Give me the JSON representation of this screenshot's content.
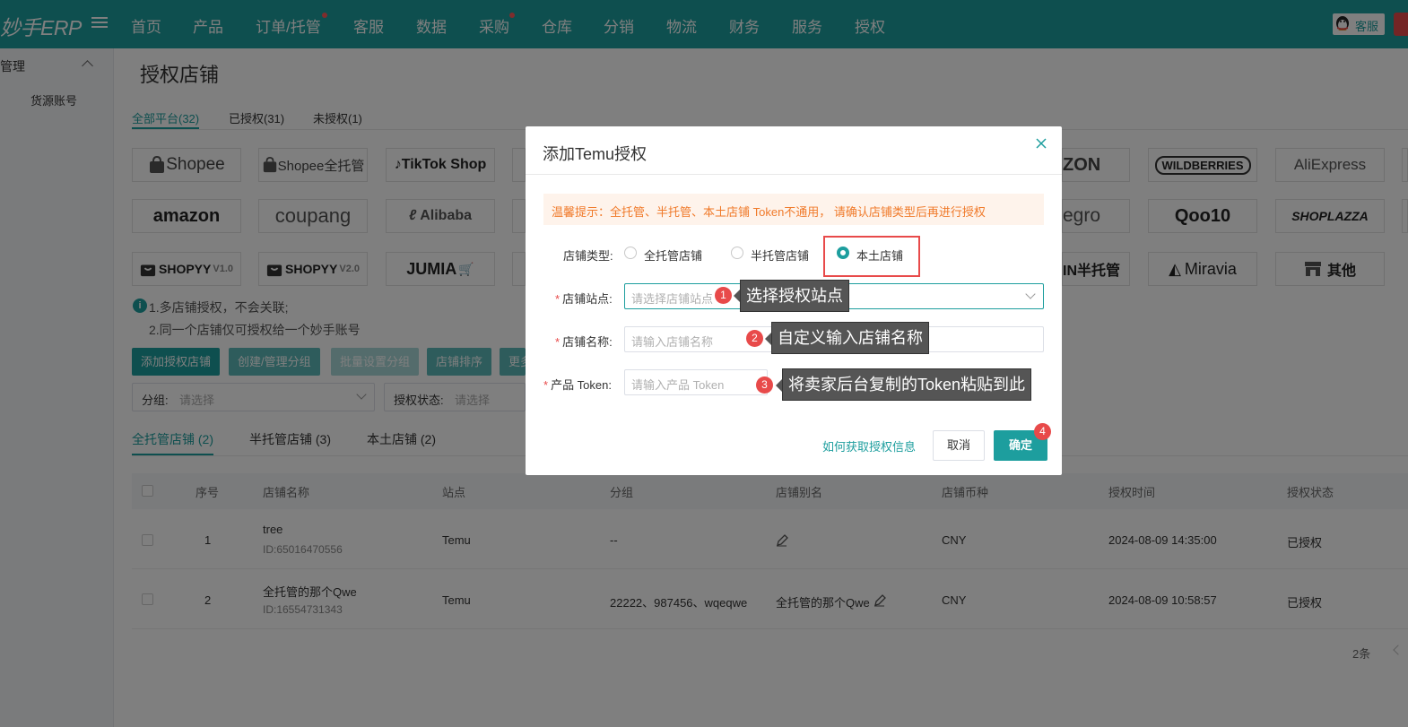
{
  "app": {
    "logo": "妙手ERP"
  },
  "nav": {
    "items": [
      "首页",
      "产品",
      "订单/托管",
      "客服",
      "数据",
      "采购",
      "仓库",
      "分销",
      "物流",
      "财务",
      "服务",
      "授权"
    ],
    "service_label": "客服"
  },
  "sidebar": {
    "group_label": "管理",
    "items": [
      "货源账号"
    ]
  },
  "page": {
    "title": "授权店铺",
    "platform_tabs": [
      "全部平台(32)",
      "已授权(31)",
      "未授权(1)"
    ],
    "platforms": {
      "shopee": "Shopee",
      "shopee_full": "Shopee全托管",
      "tiktok": "TikTok Shop",
      "ozon": "ZON",
      "wildberries": "WILDBERRIES",
      "aliexpress": "AliExpress",
      "amazon": "amazon",
      "coupang": "coupang",
      "alibaba": "Alibaba",
      "allegro": "egro",
      "qoo10": "Qoo10",
      "shoplazza": "SHOPLAZZA",
      "shopyy1": "SHOPYY",
      "shopyy1_ver": "V1.0",
      "shopyy2": "SHOPYY",
      "shopyy2_ver": "V2.0",
      "jumia": "JUMIA",
      "half_managed": "IN半托管",
      "miravia": "Miravia",
      "other": "其他"
    },
    "tips": [
      "1.多店铺授权，不会关联;",
      "2.同一个店铺仅可授权给一个妙手账号"
    ],
    "actions": [
      "添加授权店铺",
      "创建/管理分组",
      "批量设置分组",
      "店铺排序",
      "更多"
    ],
    "filters": {
      "group_label": "分组:",
      "group_placeholder": "请选择",
      "status_label": "授权状态:",
      "status_placeholder": "请选择"
    },
    "store_tabs": [
      "全托管店铺 (2)",
      "半托管店铺 (3)",
      "本土店铺 (2)"
    ],
    "table": {
      "columns": [
        "序号",
        "店铺名称",
        "站点",
        "分组",
        "店铺别名",
        "店铺币种",
        "授权时间",
        "授权状态"
      ],
      "rows": [
        {
          "index": "1",
          "name": "tree",
          "id": "ID:65016470556",
          "site": "Temu",
          "group": "--",
          "alias": "",
          "currency": "CNY",
          "time": "2024-08-09 14:35:00",
          "status": "已授权"
        },
        {
          "index": "2",
          "name": "全托管的那个Qwe",
          "id": "ID:16554731343",
          "site": "Temu",
          "group": "22222、987456、wqeqwe",
          "alias": "全托管的那个Qwe",
          "currency": "CNY",
          "time": "2024-08-09 10:58:57",
          "status": "已授权"
        }
      ]
    },
    "pager": {
      "count": "2条"
    }
  },
  "modal": {
    "title": "添加Temu授权",
    "warning": "温馨提示：全托管、半托管、本土店铺 Token不通用， 请确认店铺类型后再进行授权",
    "store_type": {
      "label": "店铺类型:",
      "options": [
        "全托管店铺",
        "半托管店铺",
        "本土店铺"
      ],
      "selected": "本土店铺"
    },
    "site": {
      "label": "店铺站点:",
      "placeholder": "请选择店铺站点"
    },
    "name": {
      "label": "店铺名称:",
      "placeholder": "请输入店铺名称"
    },
    "token": {
      "label": "产品 Token:",
      "placeholder": "请输入产品 Token"
    },
    "help_link": "如何获取授权信息",
    "cancel": "取消",
    "confirm": "确定"
  },
  "annotations": {
    "steps": [
      "1",
      "2",
      "3",
      "4"
    ],
    "callouts": [
      "选择授权站点",
      "自定义输入店铺名称",
      "将卖家后台复制的Token粘贴到此"
    ]
  },
  "colors": {
    "primary": "#1d9e9e",
    "warning_text": "#f07a2a",
    "highlight": "#e84a4a"
  }
}
